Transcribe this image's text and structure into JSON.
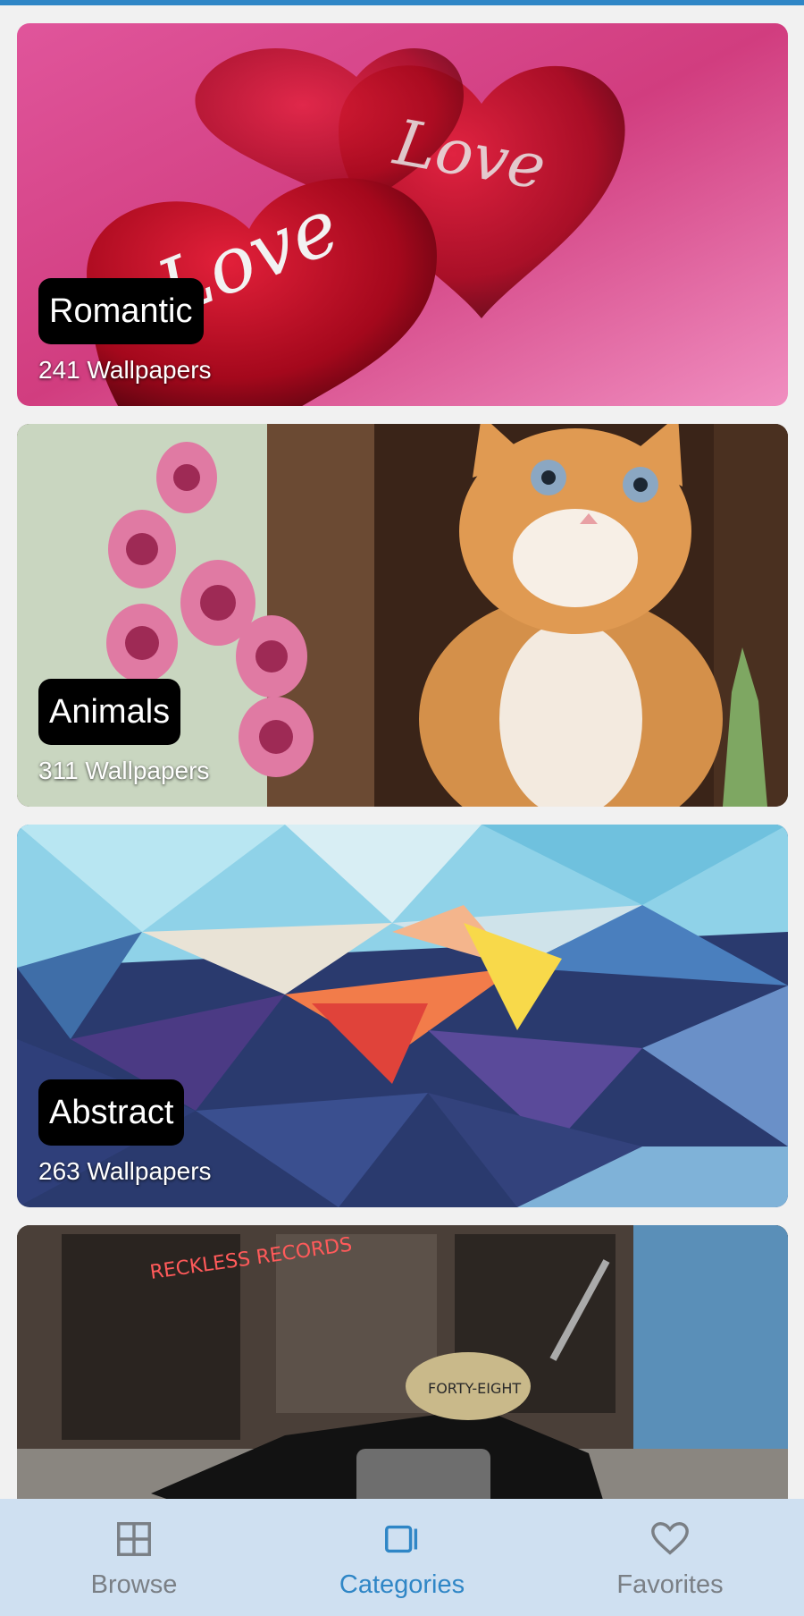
{
  "categories": [
    {
      "title": "Romantic",
      "count": "241 Wallpapers"
    },
    {
      "title": "Animals",
      "count": "311 Wallpapers"
    },
    {
      "title": "Abstract",
      "count": "263 Wallpapers"
    },
    {
      "title": "",
      "count": ""
    }
  ],
  "moto_card": {
    "sign_text": "RECKLESS RECORDS",
    "tank_text": "FORTY-EIGHT"
  },
  "nav": {
    "browse": "Browse",
    "categories": "Categories",
    "favorites": "Favorites",
    "active_color": "#2f86c6",
    "inactive_color": "#7a7f85"
  },
  "colors": {
    "accent": "#2f86c6",
    "nav_bg": "#cfe0f1",
    "pill_bg": "#000000"
  }
}
